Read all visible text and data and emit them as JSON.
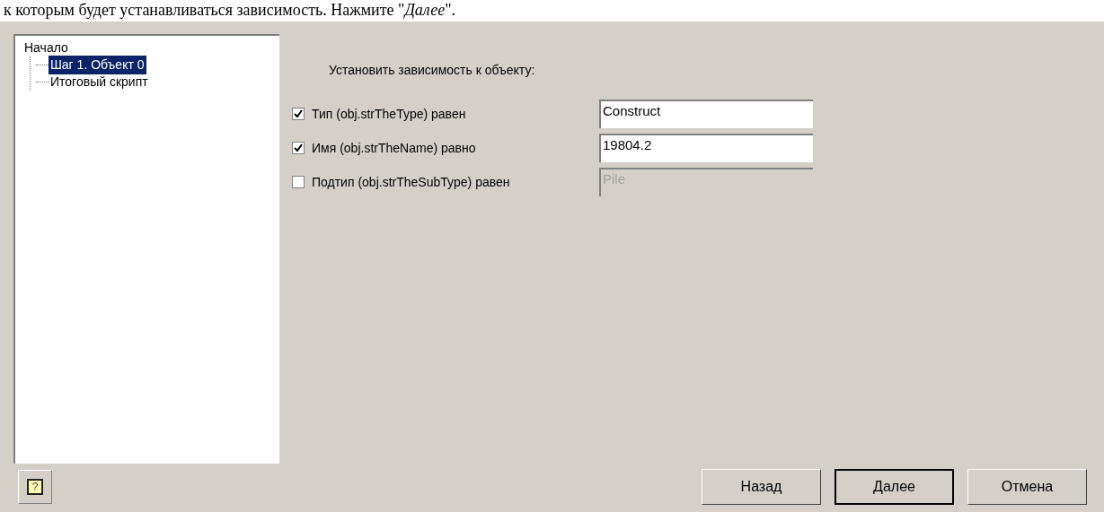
{
  "intro": "к которым будет устанавливаться зависимость. Нажмите \"*Далее*\".",
  "tree": {
    "label": "Начало",
    "selected": false,
    "children": [
      {
        "label": "Шаг 1. Объект 0",
        "selected": true
      },
      {
        "label": "Итоговый скрипт",
        "selected": false
      }
    ]
  },
  "heading": "Установить зависимость к объекту:",
  "conditions": [
    {
      "label": "Тип (obj.strTheType) равен",
      "checked": true,
      "value": "Construct"
    },
    {
      "label": "Имя (obj.strTheName) равно",
      "checked": true,
      "value": "19804.2"
    },
    {
      "label": "Подтип (obj.strTheSubType) равен",
      "checked": false,
      "value": "Pile"
    }
  ],
  "help": "?",
  "buttons": [
    {
      "label": "Назад",
      "default": false
    },
    {
      "label": "Далее",
      "default": true
    },
    {
      "label": "Отмена",
      "default": false
    }
  ]
}
